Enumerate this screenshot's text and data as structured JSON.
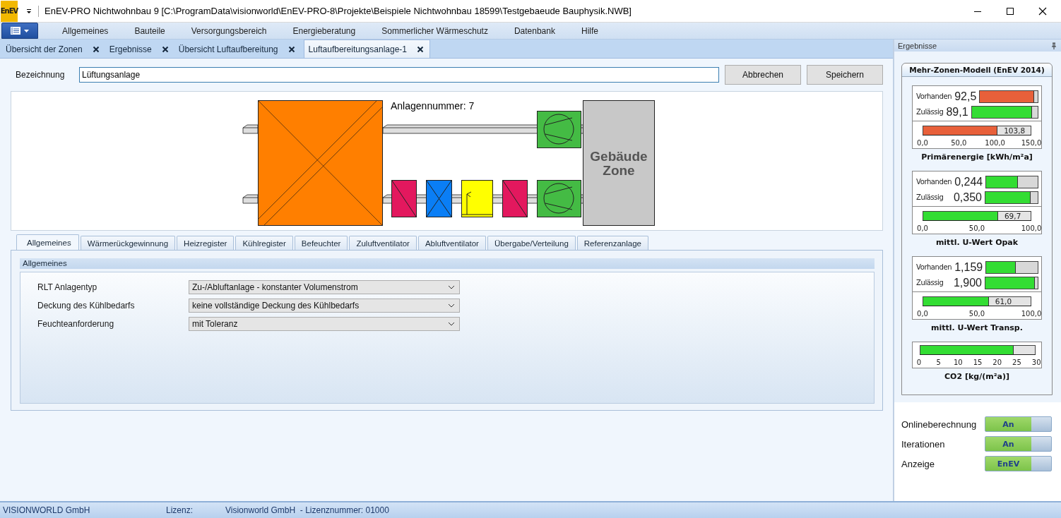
{
  "window": {
    "logo": "EnEV",
    "title": "EnEV-PRO Nichtwohnbau 9 [C:\\ProgramData\\visionworld\\EnEV-PRO-8\\Projekte\\Beispiele Nichtwohnbau 18599\\Testgebaeude Bauphysik.NWB]"
  },
  "menu": [
    "Allgemeines",
    "Bauteile",
    "Versorgungsbereich",
    "Energieberatung",
    "Sommerlicher Wärmeschutz",
    "Datenbank",
    "Hilfe"
  ],
  "doc_tabs": [
    {
      "label": "Übersicht der Zonen",
      "selected": false
    },
    {
      "label": "Ergebnisse",
      "selected": false
    },
    {
      "label": "Übersicht Luftaufbereitung",
      "selected": false
    },
    {
      "label": "Luftaufbereitungsanlage-1",
      "selected": true
    }
  ],
  "name_field": {
    "label": "Bezeichnung",
    "value": "Lüftungsanlage"
  },
  "buttons": [
    "Abbrechen",
    "Speichern"
  ],
  "diagram": {
    "plant_number": "Anlagennummer: 7",
    "zone_label": [
      "Gebäude",
      "Zone"
    ],
    "exhaust_components": [
      {
        "kind": "fan"
      }
    ],
    "supply_components": [
      {
        "kind": "heater"
      },
      {
        "kind": "cooler"
      },
      {
        "kind": "humidifier"
      },
      {
        "kind": "heater"
      },
      {
        "kind": "fan"
      }
    ]
  },
  "detail_tabs": [
    {
      "label": "Allgemeines",
      "selected": true
    },
    {
      "label": "Wärmerückgewinnung",
      "selected": false
    },
    {
      "label": "Heizregister",
      "selected": false
    },
    {
      "label": "Kühlregister",
      "selected": false
    },
    {
      "label": "Befeuchter",
      "selected": false
    },
    {
      "label": "Zuluftventilator",
      "selected": false
    },
    {
      "label": "Abluftventilator",
      "selected": false
    },
    {
      "label": "Übergabe/Verteilung",
      "selected": false
    },
    {
      "label": "Referenzanlage",
      "selected": false
    }
  ],
  "section": {
    "title": "Allgemeines",
    "fields": [
      {
        "label": "RLT Anlagentyp",
        "value": "Zu-/Abluftanlage - konstanter Volumenstrom"
      },
      {
        "label": "Deckung des Kühlbedarfs",
        "value": "keine vollständige Deckung des Kühlbedarfs"
      },
      {
        "label": "Feuchteanforderung",
        "value": "mit Toleranz"
      }
    ]
  },
  "results": {
    "title": "Ergebnisse",
    "card_title": "Mehr-Zonen-Modell (EnEV 2014)",
    "groups": [
      {
        "title": "Primärenergie [kWh/m²a]",
        "rows": [
          {
            "label": "Vorhanden",
            "value": "92,5",
            "level": 0.94,
            "color": "#e8603a"
          },
          {
            "label": "Zulässig",
            "value": "89,1",
            "level": 0.91,
            "color": "#33dd33"
          }
        ],
        "gauge": {
          "reading": "103,8",
          "level": 0.692,
          "color": "#e8603a",
          "ticks": [
            "0,0",
            "50,0",
            "100,0",
            "150,0"
          ]
        }
      },
      {
        "title": "mittl. U-Wert Opak",
        "rows": [
          {
            "label": "Vorhanden",
            "value": "0,244",
            "level": 0.62,
            "color": "#33dd33"
          },
          {
            "label": "Zulässig",
            "value": "0,350",
            "level": 0.87,
            "color": "#33dd33"
          }
        ],
        "gauge": {
          "reading": "69,7",
          "level": 0.697,
          "color": "#33dd33",
          "ticks": [
            "0,0",
            "50,0",
            "100,0"
          ]
        }
      },
      {
        "title": "mittl. U-Wert Transp.",
        "rows": [
          {
            "label": "Vorhanden",
            "value": "1,159",
            "level": 0.57,
            "color": "#33dd33"
          },
          {
            "label": "Zulässig",
            "value": "1,900",
            "level": 0.94,
            "color": "#33dd33"
          }
        ],
        "gauge": {
          "reading": "61,0",
          "level": 0.61,
          "color": "#33dd33",
          "ticks": [
            "0,0",
            "50,0",
            "100,0"
          ]
        }
      },
      {
        "title": "CO2 [kg/(m²a)]",
        "gauge": {
          "level": 0.815,
          "color": "#33dd33",
          "ticks": [
            "0",
            "5",
            "10",
            "15",
            "20",
            "25",
            "30"
          ]
        }
      }
    ],
    "toggles": [
      {
        "label": "Onlineberechnung",
        "value": "An",
        "on": true
      },
      {
        "label": "Iterationen",
        "value": "An",
        "on": true
      },
      {
        "label": "Anzeige",
        "value": "EnEV",
        "on": true
      }
    ]
  },
  "status_bar": [
    "VISIONWORLD GmbH",
    "Lizenz:",
    "Visionworld GmbH  - Lizenznummer: 01000"
  ]
}
